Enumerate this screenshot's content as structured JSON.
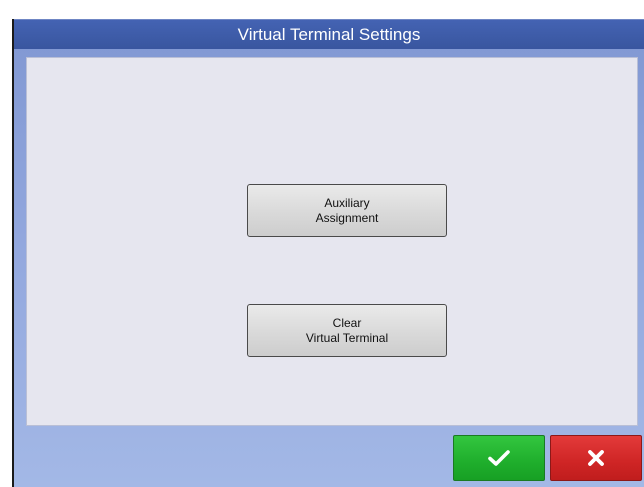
{
  "dialog": {
    "title": "Virtual Terminal Settings"
  },
  "buttons": {
    "auxiliary_assignment": {
      "line1": "Auxiliary",
      "line2": "Assignment"
    },
    "clear_virtual_terminal": {
      "line1": "Clear",
      "line2": "Virtual Terminal"
    }
  },
  "footer": {
    "confirm_icon": "checkmark-icon",
    "cancel_icon": "close-icon"
  },
  "colors": {
    "title_bar": "#39569f",
    "dialog_background": "#93a8de",
    "content_panel": "#e6e6ef",
    "confirm": "#1fae2c",
    "cancel": "#cf2525"
  }
}
